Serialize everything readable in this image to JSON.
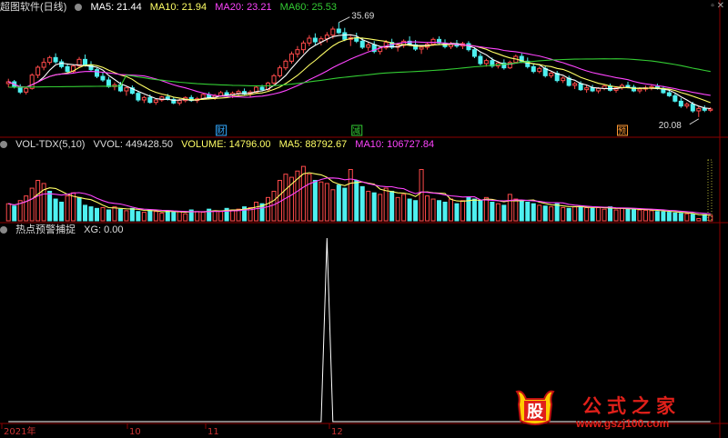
{
  "window": {
    "title": "超图软件(日线)"
  },
  "price_header": {
    "ma5": "MA5: 21.44",
    "ma10": "MA10: 21.94",
    "ma20": "MA20: 23.21",
    "ma60": "MA60: 25.53"
  },
  "vol_header": {
    "name": "VOL-TDX(5,10)",
    "vvol": "VVOL: 449428.50",
    "volume": "VOLUME: 14796.00",
    "ma5": "MA5: 88792.67",
    "ma10": "MA10: 106727.84"
  },
  "ind_header": {
    "name": "热点预警捕捉",
    "xg": "XG: 0.00"
  },
  "annotations": {
    "high": "35.69",
    "low": "20.08",
    "tag1": "财",
    "tag2": "减",
    "tag3": "预"
  },
  "xaxis": {
    "labels": [
      "2021年",
      "10",
      "11",
      "12"
    ]
  },
  "watermark": {
    "text": "公式之家",
    "url": "www.gszj100.com",
    "badge": "股"
  },
  "colors": {
    "up": "#ff4a4a",
    "down": "#4ef0f0",
    "ma5": "#ffffff",
    "ma10": "#ffff66",
    "ma20": "#ff44ff",
    "ma60": "#33cc33",
    "grid": "#8b0000"
  },
  "chart_data": [
    {
      "type": "candlestick",
      "title": "超图软件(日线)",
      "high_marker": 35.69,
      "low_marker": 20.08,
      "ylim": [
        19,
        37
      ],
      "ohlc": [
        [
          25.6,
          26.4,
          25.0,
          25.9
        ],
        [
          25.9,
          26.2,
          24.8,
          25.1
        ],
        [
          25.1,
          25.5,
          23.9,
          24.2
        ],
        [
          24.2,
          25.0,
          23.8,
          24.8
        ],
        [
          24.8,
          27.3,
          24.6,
          27.0
        ],
        [
          27.0,
          28.6,
          26.5,
          28.3
        ],
        [
          28.3,
          29.8,
          27.8,
          29.1
        ],
        [
          29.1,
          30.2,
          28.7,
          29.9
        ],
        [
          29.9,
          30.6,
          28.9,
          29.2
        ],
        [
          29.2,
          29.6,
          28.1,
          28.4
        ],
        [
          28.4,
          28.9,
          27.2,
          27.6
        ],
        [
          27.6,
          28.8,
          27.3,
          28.5
        ],
        [
          28.5,
          30.0,
          28.2,
          29.6
        ],
        [
          29.6,
          30.4,
          28.4,
          28.7
        ],
        [
          28.7,
          29.3,
          27.6,
          27.9
        ],
        [
          27.9,
          28.2,
          26.5,
          26.8
        ],
        [
          26.8,
          27.4,
          25.9,
          26.2
        ],
        [
          26.2,
          26.7,
          24.9,
          25.1
        ],
        [
          25.1,
          25.8,
          24.5,
          25.4
        ],
        [
          25.4,
          25.9,
          24.2,
          24.4
        ],
        [
          24.4,
          25.1,
          23.6,
          24.9
        ],
        [
          24.9,
          25.3,
          23.8,
          24.0
        ],
        [
          24.0,
          24.4,
          22.6,
          22.9
        ],
        [
          22.9,
          23.6,
          22.4,
          23.3
        ],
        [
          23.3,
          23.8,
          22.3,
          22.5
        ],
        [
          22.5,
          23.2,
          22.1,
          22.9
        ],
        [
          22.9,
          23.6,
          22.6,
          23.4
        ],
        [
          23.4,
          23.9,
          22.8,
          23.0
        ],
        [
          23.0,
          23.4,
          22.2,
          22.4
        ],
        [
          22.4,
          23.1,
          22.0,
          22.8
        ],
        [
          22.8,
          23.5,
          22.5,
          23.3
        ],
        [
          23.3,
          23.7,
          22.6,
          22.8
        ],
        [
          22.8,
          23.4,
          22.4,
          23.1
        ],
        [
          23.1,
          24.0,
          22.9,
          23.8
        ],
        [
          23.8,
          24.2,
          23.0,
          23.3
        ],
        [
          23.3,
          23.9,
          22.9,
          23.6
        ],
        [
          23.6,
          24.4,
          23.4,
          24.1
        ],
        [
          24.1,
          24.5,
          23.5,
          23.7
        ],
        [
          23.7,
          24.3,
          23.2,
          24.0
        ],
        [
          24.0,
          24.6,
          23.6,
          24.3
        ],
        [
          24.3,
          24.8,
          23.7,
          23.9
        ],
        [
          23.9,
          24.5,
          23.4,
          24.2
        ],
        [
          24.2,
          25.3,
          24.0,
          25.0
        ],
        [
          25.0,
          25.4,
          24.3,
          24.6
        ],
        [
          24.6,
          25.9,
          24.4,
          25.7
        ],
        [
          25.7,
          27.2,
          25.4,
          26.9
        ],
        [
          26.9,
          28.6,
          26.6,
          28.2
        ],
        [
          28.2,
          29.6,
          27.8,
          29.3
        ],
        [
          29.3,
          30.9,
          28.9,
          30.5
        ],
        [
          30.5,
          31.8,
          29.9,
          31.2
        ],
        [
          31.2,
          32.7,
          30.6,
          32.3
        ],
        [
          32.3,
          33.6,
          31.8,
          33.1
        ],
        [
          33.1,
          33.9,
          32.0,
          32.5
        ],
        [
          32.5,
          33.4,
          31.9,
          33.0
        ],
        [
          33.0,
          34.1,
          32.4,
          33.6
        ],
        [
          33.6,
          35.0,
          33.0,
          34.6
        ],
        [
          34.6,
          35.69,
          33.8,
          34.0
        ],
        [
          34.0,
          34.8,
          32.6,
          32.9
        ],
        [
          32.9,
          33.5,
          31.8,
          33.2
        ],
        [
          33.2,
          34.0,
          32.3,
          32.6
        ],
        [
          32.6,
          33.2,
          31.3,
          31.6
        ],
        [
          31.6,
          32.4,
          31.0,
          32.0
        ],
        [
          32.0,
          32.6,
          30.6,
          30.9
        ],
        [
          30.9,
          31.8,
          30.4,
          31.5
        ],
        [
          31.5,
          32.8,
          31.2,
          32.4
        ],
        [
          32.4,
          33.0,
          31.3,
          31.6
        ],
        [
          31.6,
          32.3,
          30.9,
          31.9
        ],
        [
          31.9,
          32.9,
          31.5,
          32.6
        ],
        [
          32.6,
          33.4,
          31.8,
          32.0
        ],
        [
          32.0,
          32.8,
          31.0,
          31.3
        ],
        [
          31.3,
          31.9,
          30.5,
          31.6
        ],
        [
          31.6,
          32.4,
          31.2,
          32.1
        ],
        [
          32.1,
          33.2,
          31.8,
          32.9
        ],
        [
          32.9,
          33.4,
          32.0,
          32.3
        ],
        [
          32.3,
          32.9,
          31.4,
          31.7
        ],
        [
          31.7,
          32.5,
          31.3,
          32.2
        ],
        [
          32.2,
          32.8,
          31.5,
          31.8
        ],
        [
          31.8,
          32.5,
          31.3,
          32.2
        ],
        [
          32.2,
          32.6,
          30.9,
          31.2
        ],
        [
          31.2,
          31.6,
          29.8,
          30.1
        ],
        [
          30.1,
          30.6,
          28.6,
          28.9
        ],
        [
          28.9,
          29.7,
          28.4,
          29.4
        ],
        [
          29.4,
          29.9,
          28.2,
          28.5
        ],
        [
          28.5,
          29.3,
          28.1,
          29.0
        ],
        [
          29.0,
          29.6,
          27.9,
          28.2
        ],
        [
          28.2,
          29.4,
          28.0,
          29.1
        ],
        [
          29.1,
          30.4,
          28.9,
          30.1
        ],
        [
          30.1,
          30.6,
          29.0,
          29.3
        ],
        [
          29.3,
          29.9,
          28.1,
          28.4
        ],
        [
          28.4,
          28.9,
          27.3,
          27.6
        ],
        [
          27.6,
          28.4,
          27.3,
          28.1
        ],
        [
          28.1,
          28.6,
          26.6,
          26.9
        ],
        [
          26.9,
          27.6,
          26.5,
          27.3
        ],
        [
          27.3,
          27.7,
          25.8,
          26.1
        ],
        [
          26.1,
          26.8,
          25.7,
          26.5
        ],
        [
          26.5,
          26.9,
          25.1,
          25.3
        ],
        [
          25.3,
          25.9,
          24.7,
          25.6
        ],
        [
          25.6,
          26.0,
          24.4,
          24.6
        ],
        [
          24.6,
          25.3,
          24.1,
          24.9
        ],
        [
          24.9,
          25.4,
          24.2,
          24.4
        ],
        [
          24.4,
          25.0,
          24.0,
          24.8
        ],
        [
          24.8,
          25.5,
          24.5,
          25.2
        ],
        [
          25.2,
          25.6,
          24.3,
          24.5
        ],
        [
          24.5,
          25.1,
          24.1,
          24.9
        ],
        [
          24.9,
          25.6,
          24.6,
          25.3
        ],
        [
          25.3,
          25.9,
          24.8,
          25.0
        ],
        [
          25.0,
          25.4,
          24.2,
          24.4
        ],
        [
          24.4,
          25.0,
          24.0,
          24.7
        ],
        [
          24.7,
          25.3,
          24.3,
          24.9
        ],
        [
          24.9,
          25.5,
          24.5,
          25.1
        ],
        [
          25.1,
          25.6,
          24.6,
          24.8
        ],
        [
          24.8,
          25.2,
          23.9,
          24.1
        ],
        [
          24.1,
          24.6,
          23.4,
          23.6
        ],
        [
          23.6,
          24.0,
          22.5,
          22.7
        ],
        [
          22.7,
          23.2,
          21.6,
          21.9
        ],
        [
          21.9,
          22.5,
          21.5,
          22.2
        ],
        [
          22.2,
          22.6,
          20.8,
          21.1
        ],
        [
          21.1,
          21.8,
          20.08,
          21.5
        ],
        [
          21.5,
          22.0,
          20.9,
          21.2
        ],
        [
          21.2,
          21.7,
          20.9,
          21.4
        ]
      ],
      "ma60_note": "green long-term average line"
    },
    {
      "type": "bar",
      "title": "VOL-TDX(5,10)",
      "ylim": [
        0,
        450000
      ],
      "values": [
        110000,
        95000,
        130000,
        160000,
        210000,
        260000,
        240000,
        190000,
        140000,
        120000,
        160000,
        180000,
        150000,
        100000,
        90000,
        80000,
        85000,
        70000,
        90000,
        75000,
        65000,
        80000,
        60000,
        55000,
        70000,
        60000,
        50000,
        65000,
        55000,
        60000,
        45000,
        70000,
        60000,
        55000,
        75000,
        65000,
        60000,
        80000,
        70000,
        75000,
        90000,
        85000,
        120000,
        110000,
        150000,
        190000,
        260000,
        300000,
        280000,
        320000,
        350000,
        300000,
        260000,
        250000,
        240000,
        200000,
        230000,
        210000,
        330000,
        260000,
        220000,
        190000,
        180000,
        170000,
        210000,
        190000,
        150000,
        170000,
        140000,
        130000,
        330000,
        160000,
        140000,
        130000,
        120000,
        140000,
        110000,
        130000,
        150000,
        140000,
        130000,
        150000,
        120000,
        110000,
        100000,
        170000,
        140000,
        130000,
        120000,
        110000,
        100000,
        95000,
        90000,
        110000,
        85000,
        80000,
        90000,
        95000,
        85000,
        80000,
        85000,
        75000,
        90000,
        70000,
        80000,
        75000,
        72000,
        70000,
        68000,
        65000,
        60000,
        58000,
        55000,
        50000,
        48000,
        45000,
        42000,
        14796,
        40000,
        35000
      ],
      "up": [
        1,
        0,
        1,
        1,
        1,
        1,
        1,
        0,
        0,
        0,
        1,
        1,
        0,
        0,
        0,
        0,
        1,
        0,
        1,
        0,
        1,
        0,
        0,
        1,
        0,
        1,
        1,
        0,
        0,
        1,
        1,
        0,
        1,
        1,
        0,
        1,
        1,
        0,
        1,
        1,
        0,
        1,
        1,
        0,
        1,
        1,
        1,
        1,
        1,
        1,
        1,
        1,
        0,
        1,
        1,
        1,
        0,
        0,
        1,
        0,
        0,
        1,
        0,
        1,
        1,
        0,
        1,
        1,
        0,
        0,
        1,
        1,
        1,
        0,
        0,
        1,
        0,
        1,
        0,
        0,
        0,
        1,
        0,
        1,
        0,
        1,
        1,
        0,
        0,
        0,
        1,
        0,
        1,
        0,
        1,
        0,
        1,
        0,
        1,
        0,
        1,
        1,
        0,
        1,
        1,
        0,
        0,
        1,
        1,
        1,
        0,
        0,
        0,
        0,
        0,
        1,
        0,
        1,
        0,
        1
      ]
    },
    {
      "type": "line",
      "title": "热点预警捕捉",
      "ylim": [
        0,
        1
      ],
      "spike_index": 54,
      "value_label": "XG: 0.00"
    }
  ]
}
